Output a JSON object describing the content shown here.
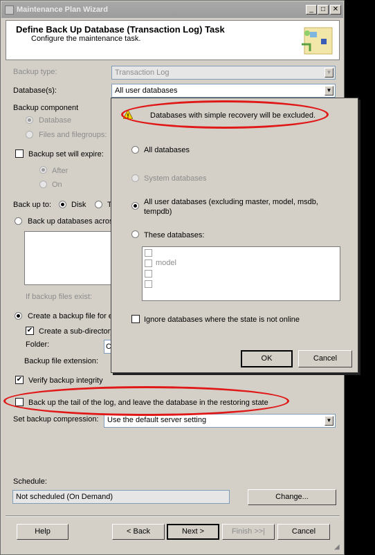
{
  "window": {
    "title": "Maintenance Plan Wizard"
  },
  "header": {
    "title": "Define Back Up Database (Transaction Log) Task",
    "subtitle": "Configure the maintenance task."
  },
  "form": {
    "backup_type_label": "Backup type:",
    "backup_type_value": "Transaction Log",
    "databases_label": "Database(s):",
    "databases_value": "All user databases",
    "backup_component_label": "Backup component",
    "component_database": "Database",
    "component_files": "Files and filegroups:",
    "set_expire_label": "Backup set will expire:",
    "after_label": "After",
    "on_label": "On",
    "backup_to_label": "Back up to:",
    "disk_label": "Disk",
    "tape_label": "T",
    "across_label": "Back up databases acros",
    "if_exist_label": "If backup files exist:",
    "create_file_label": "Create a backup file for ev",
    "sub_dir_label": "Create a sub-directory",
    "folder_label": "Folder:",
    "folder_value": "C",
    "extension_label": "Backup file extension:",
    "verify_label": "Verify backup integrity",
    "tail_log_label": "Back up the tail of the log, and leave the database in the restoring state",
    "compression_label": "Set backup compression:",
    "compression_value": "Use the default server setting",
    "schedule_label": "Schedule:",
    "schedule_value": "Not scheduled (On Demand)",
    "change_button": "Change..."
  },
  "buttons": {
    "help": "Help",
    "back": "< Back",
    "next": "Next >",
    "finish": "Finish >>|",
    "cancel": "Cancel"
  },
  "popup": {
    "warning": "Databases with simple recovery will be excluded.",
    "all_databases": "All databases",
    "system_databases": "System databases",
    "all_user_databases_line1": "All user databases  (excluding master, model, msdb,",
    "all_user_databases_line2": "tempdb)",
    "these_databases": "These databases:",
    "list_items": [
      "model"
    ],
    "ignore_offline": "Ignore databases where the state is not online",
    "ok": "OK",
    "cancel": "Cancel"
  },
  "colors": {
    "annotation": "#e01818",
    "window_bg": "#d4d0c8"
  }
}
